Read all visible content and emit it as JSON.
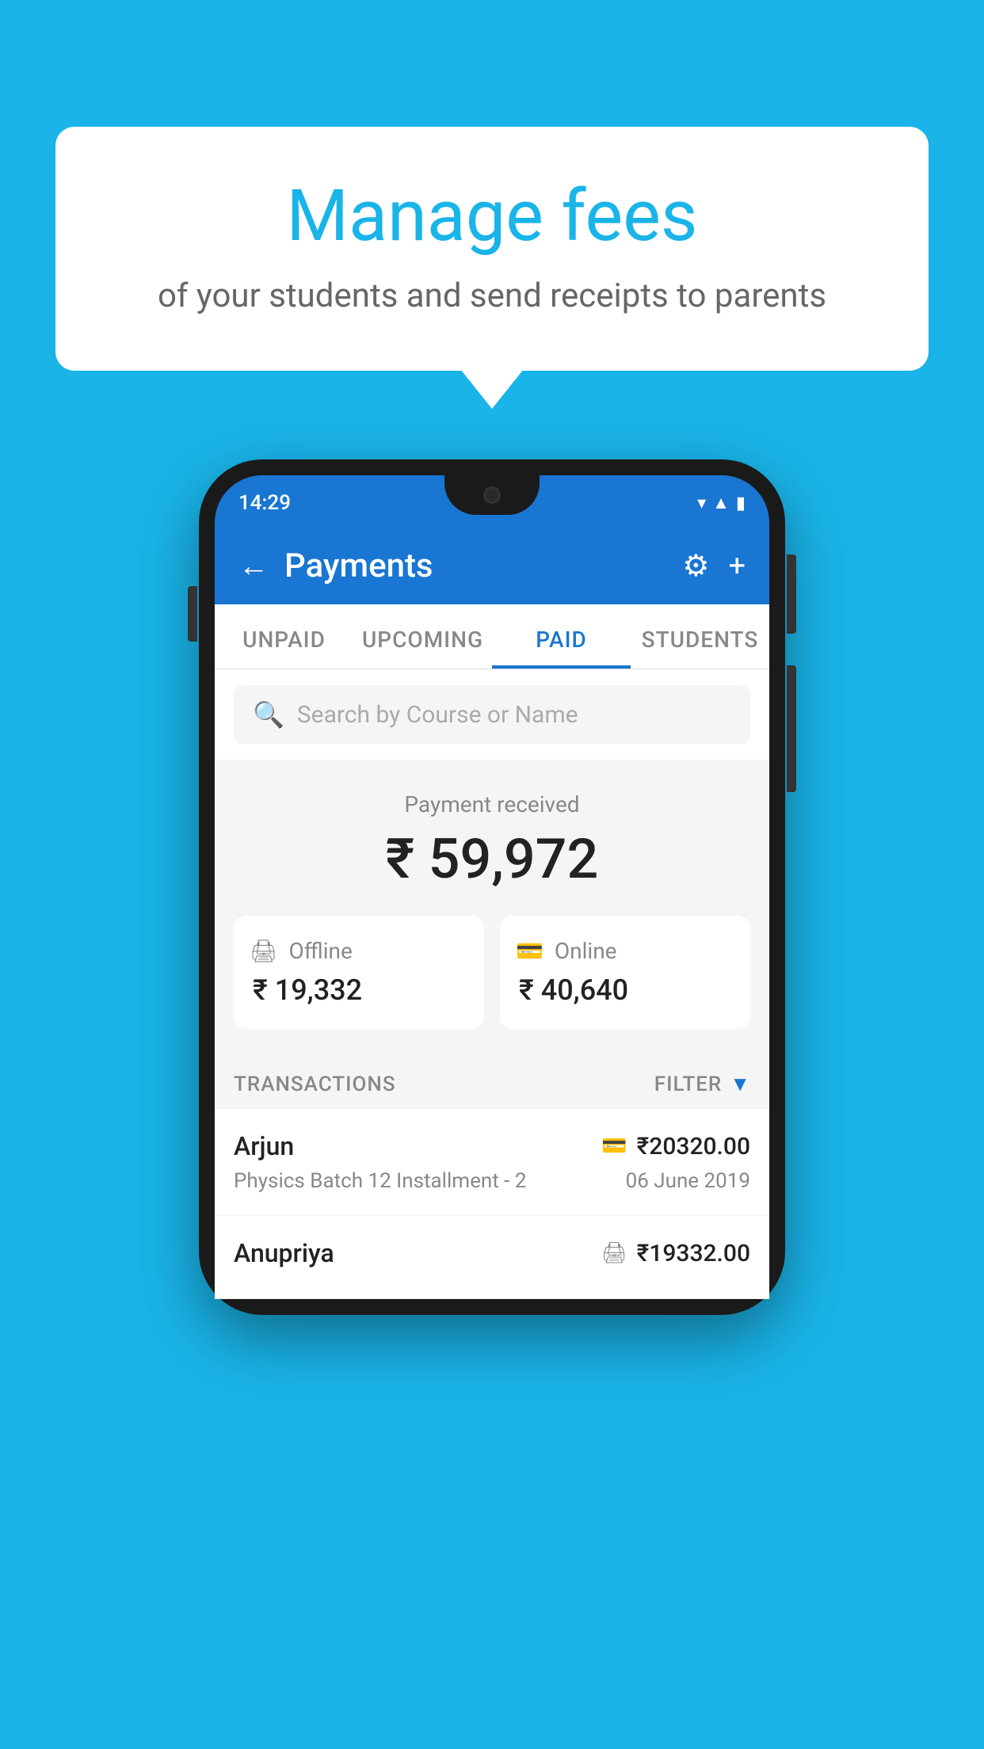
{
  "background": {
    "color": "#1ab4e8"
  },
  "speech_bubble": {
    "headline": "Manage fees",
    "subtext": "of your students and send receipts to parents"
  },
  "phone": {
    "status_bar": {
      "time": "14:29"
    },
    "header": {
      "title": "Payments",
      "back_label": "←",
      "settings_icon": "gear",
      "add_icon": "+"
    },
    "tabs": [
      {
        "label": "UNPAID",
        "active": false
      },
      {
        "label": "UPCOMING",
        "active": false
      },
      {
        "label": "PAID",
        "active": true
      },
      {
        "label": "STUDENTS",
        "active": false
      }
    ],
    "search": {
      "placeholder": "Search by Course or Name"
    },
    "payment_summary": {
      "label": "Payment received",
      "total": "₹ 59,972",
      "offline": {
        "type": "Offline",
        "amount": "₹ 19,332"
      },
      "online": {
        "type": "Online",
        "amount": "₹ 40,640"
      }
    },
    "transactions": {
      "label": "TRANSACTIONS",
      "filter_label": "FILTER",
      "items": [
        {
          "name": "Arjun",
          "course": "Physics Batch 12 Installment - 2",
          "amount": "₹20320.00",
          "date": "06 June 2019",
          "type": "online"
        },
        {
          "name": "Anupriya",
          "course": "",
          "amount": "₹19332.00",
          "date": "",
          "type": "offline"
        }
      ]
    }
  }
}
